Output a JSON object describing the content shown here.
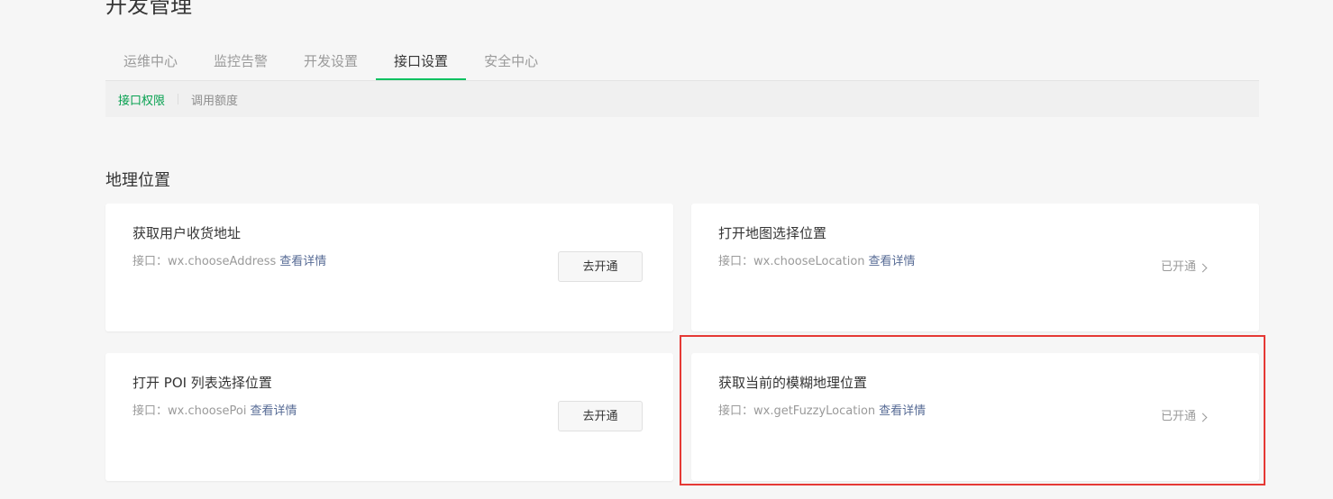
{
  "page": {
    "title": "开发管理"
  },
  "tabs": [
    {
      "label": "运维中心",
      "active": false
    },
    {
      "label": "监控告警",
      "active": false
    },
    {
      "label": "开发设置",
      "active": false
    },
    {
      "label": "接口设置",
      "active": true
    },
    {
      "label": "安全中心",
      "active": false
    }
  ],
  "subtabs": [
    {
      "label": "接口权限",
      "active": true
    },
    {
      "label": "调用额度",
      "active": false
    }
  ],
  "section": {
    "title": "地理位置"
  },
  "cards": [
    {
      "title": "获取用户收货地址",
      "api_prefix": "接口：wx.chooseAddress",
      "detail_link": "查看详情",
      "action_label": "去开通",
      "status": "not-enabled"
    },
    {
      "title": "打开地图选择位置",
      "api_prefix": "接口：wx.chooseLocation",
      "detail_link": "查看详情",
      "action_label": "已开通",
      "status": "enabled"
    },
    {
      "title": "打开 POI 列表选择位置",
      "api_prefix": "接口：wx.choosePoi",
      "detail_link": "查看详情",
      "action_label": "去开通",
      "status": "not-enabled"
    },
    {
      "title": "获取当前的模糊地理位置",
      "api_prefix": "接口：wx.getFuzzyLocation",
      "detail_link": "查看详情",
      "action_label": "已开通",
      "status": "enabled"
    }
  ],
  "colors": {
    "accent": "#07c160",
    "link": "#576b95",
    "highlight": "#e53935"
  }
}
